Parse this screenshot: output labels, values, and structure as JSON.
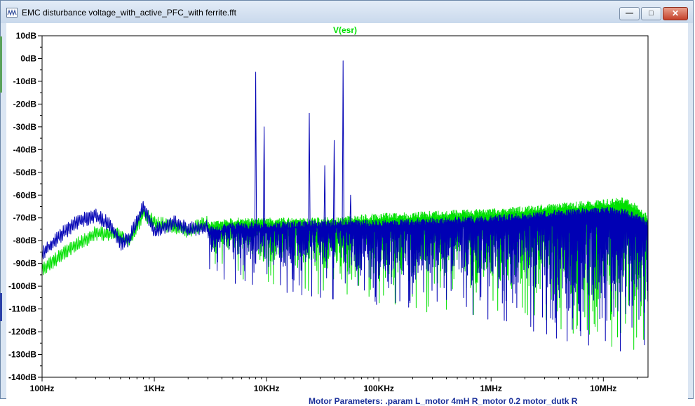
{
  "window": {
    "title": "EMC disturbance voltage_with_active_PFC_with ferrite.fft",
    "app_icon": "waveform-icon",
    "controls": {
      "minimize": "minimize-icon",
      "maximize": "maximize-icon",
      "close": "close-icon"
    }
  },
  "chart_data": {
    "type": "line",
    "title": "V(esr)",
    "x_scale": "log",
    "xlim_hz": [
      100,
      25000000
    ],
    "ylim_db": [
      -140,
      10
    ],
    "grid": false,
    "x_ticks": [
      "100Hz",
      "1KHz",
      "10KHz",
      "100KHz",
      "1MHz",
      "10MHz"
    ],
    "y_ticks": [
      "10dB",
      "0dB",
      "-10dB",
      "-20dB",
      "-30dB",
      "-40dB",
      "-50dB",
      "-60dB",
      "-70dB",
      "-80dB",
      "-90dB",
      "-100dB",
      "-110dB",
      "-120dB",
      "-130dB",
      "-140dB"
    ],
    "series": [
      {
        "name": "V(esr)",
        "color": "#00e000",
        "points": [
          [
            100,
            -93
          ],
          [
            150,
            -86
          ],
          [
            200,
            -82
          ],
          [
            300,
            -77
          ],
          [
            450,
            -77
          ],
          [
            600,
            -80
          ],
          [
            800,
            -68
          ],
          [
            1000,
            -72
          ],
          [
            1500,
            -74
          ],
          [
            2000,
            -76
          ],
          [
            3000,
            -72
          ],
          [
            5000,
            -70
          ],
          [
            10000,
            -70
          ],
          [
            30000,
            -70
          ],
          [
            100000,
            -68
          ],
          [
            300000,
            -67
          ],
          [
            1000000,
            -66
          ],
          [
            3000000,
            -64
          ],
          [
            10000000,
            -62
          ],
          [
            15000000,
            -61
          ],
          [
            20000000,
            -64
          ],
          [
            25000000,
            -69
          ]
        ],
        "floor": [
          [
            3000,
            -84
          ],
          [
            10000,
            -90
          ],
          [
            100000,
            -100
          ],
          [
            1000000,
            -104
          ],
          [
            3000000,
            -108
          ],
          [
            10000000,
            -116
          ],
          [
            25000000,
            -120
          ]
        ]
      },
      {
        "name": "",
        "color": "#0000b4",
        "points": [
          [
            100,
            -86
          ],
          [
            150,
            -77
          ],
          [
            200,
            -72
          ],
          [
            300,
            -69
          ],
          [
            400,
            -73
          ],
          [
            500,
            -81
          ],
          [
            600,
            -79
          ],
          [
            800,
            -65
          ],
          [
            1000,
            -76
          ],
          [
            1500,
            -72
          ],
          [
            2000,
            -75
          ],
          [
            3000,
            -74
          ],
          [
            5000,
            -72
          ],
          [
            10000,
            -72
          ],
          [
            30000,
            -71
          ],
          [
            100000,
            -71
          ],
          [
            300000,
            -70
          ],
          [
            1000000,
            -69
          ],
          [
            3000000,
            -67
          ],
          [
            10000000,
            -65
          ],
          [
            15000000,
            -66
          ],
          [
            20000000,
            -68
          ],
          [
            25000000,
            -71
          ]
        ],
        "floor": [
          [
            3000,
            -86
          ],
          [
            10000,
            -92
          ],
          [
            100000,
            -100
          ],
          [
            1000000,
            -106
          ],
          [
            3000000,
            -112
          ],
          [
            10000000,
            -118
          ],
          [
            25000000,
            -124
          ]
        ],
        "peaks": [
          [
            8000,
            -6
          ],
          [
            9500,
            -30
          ],
          [
            24000,
            -24
          ],
          [
            33000,
            -47
          ],
          [
            40000,
            -36
          ],
          [
            48000,
            -1
          ],
          [
            56000,
            -60
          ]
        ]
      }
    ]
  },
  "below_window": {
    "partial_text": "Motor Parameters:  .param L_motor 4mH R_motor 0.2 motor_dutk R"
  }
}
